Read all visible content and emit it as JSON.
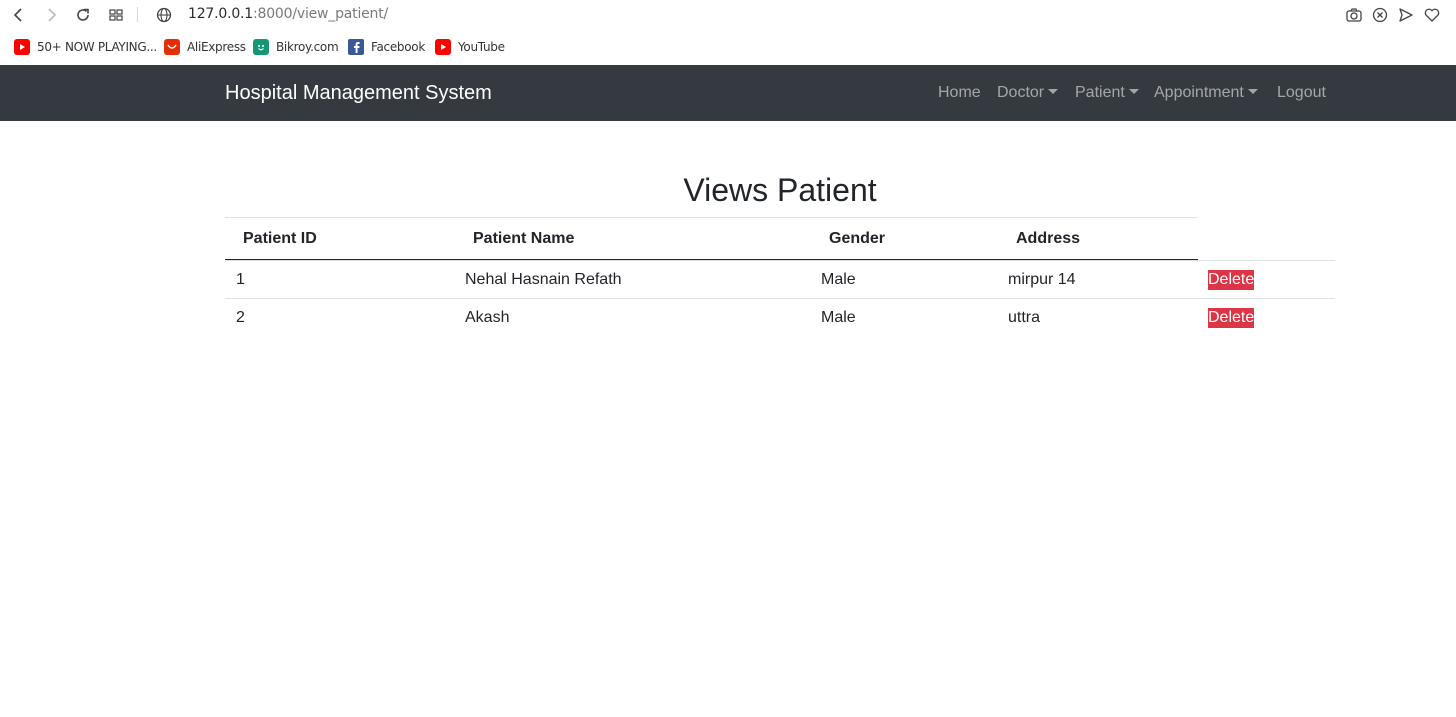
{
  "browser": {
    "url_host": "127.0.0.1",
    "url_path": ":8000/view_patient/",
    "bookmarks": [
      {
        "label": "50+ NOW PLAYING...",
        "icon": "youtube-icon",
        "color": "#ff0000"
      },
      {
        "label": "AliExpress",
        "icon": "aliexpress-icon",
        "color": "#e62e04"
      },
      {
        "label": "Bikroy.com",
        "icon": "bikroy-icon",
        "color": "#149777"
      },
      {
        "label": "Facebook",
        "icon": "facebook-icon",
        "color": "#3b5998"
      },
      {
        "label": "YouTube",
        "icon": "youtube-icon",
        "color": "#ff0000"
      }
    ]
  },
  "navbar": {
    "brand": "Hospital Management System",
    "links": {
      "home": "Home",
      "doctor": "Doctor",
      "patient": "Patient",
      "appointment": "Appointment",
      "logout": "Logout"
    },
    "bg_color": "#343a40"
  },
  "page": {
    "title": "Views Patient",
    "table": {
      "headers": [
        "Patient ID",
        "Patient Name",
        "Gender",
        "Address"
      ],
      "rows": [
        {
          "id": "1",
          "name": "Nehal Hasnain Refath",
          "gender": "Male",
          "address": "mirpur 14",
          "action": "Delete"
        },
        {
          "id": "2",
          "name": "Akash",
          "gender": "Male",
          "address": "uttra",
          "action": "Delete"
        }
      ]
    },
    "delete_color": "#dc3545"
  }
}
